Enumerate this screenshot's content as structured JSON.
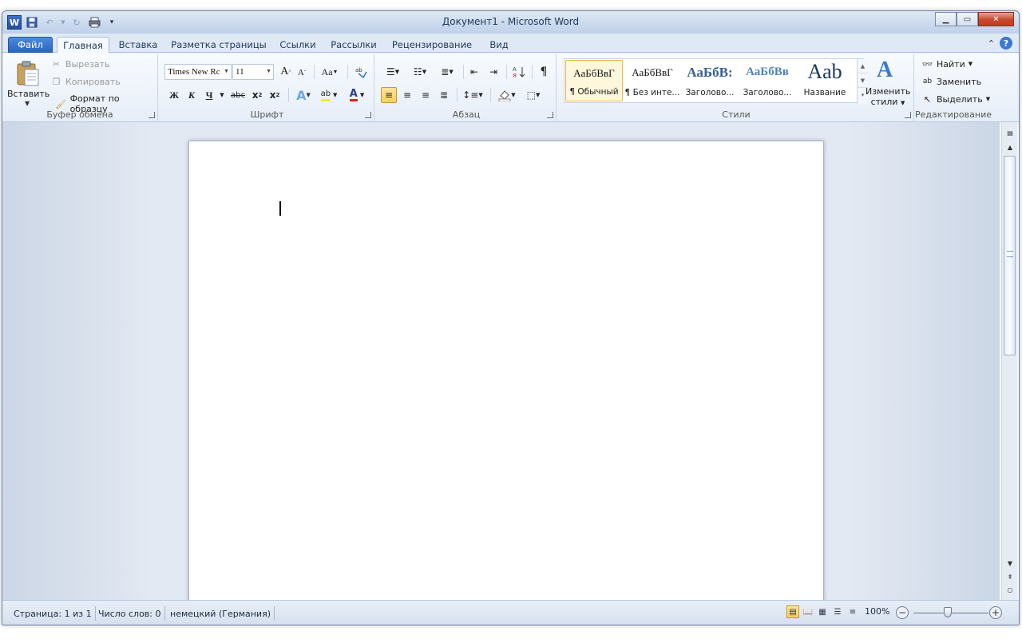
{
  "window": {
    "title": "Документ1  -  Microsoft Word"
  },
  "qat": {
    "app_icon": "word-logo",
    "app_letter": "W",
    "buttons": [
      "save-icon",
      "undo-icon",
      "redo-icon",
      "print-icon",
      "customize-icon"
    ]
  },
  "tabs": {
    "file": "Файл",
    "items": [
      "Главная",
      "Вставка",
      "Разметка страницы",
      "Ссылки",
      "Рассылки",
      "Рецензирование",
      "Вид"
    ],
    "active": "Главная"
  },
  "clipboard": {
    "paste": "Вставить",
    "cut": "Вырезать",
    "copy": "Копировать",
    "format_painter": "Формат по образцу",
    "label": "Буфер обмена"
  },
  "font": {
    "family": "Times New Rc",
    "size": "11",
    "grow": "A",
    "shrink": "A",
    "case": "Aa",
    "bold": "Ж",
    "italic": "К",
    "underline": "Ч",
    "strike": "abc",
    "subscript": "x",
    "superscript": "x",
    "effects": "A",
    "highlight": "ab",
    "color": "A",
    "label": "Шрифт"
  },
  "paragraph": {
    "pilcrow": "¶",
    "label": "Абзац"
  },
  "styles": {
    "items": [
      {
        "preview": "АаБбВвГ",
        "name": "¶ Обычный"
      },
      {
        "preview": "АаБбВвГ",
        "name": "¶ Без инте..."
      },
      {
        "preview": "АаБбВ:",
        "name": "Заголово..."
      },
      {
        "preview": "АаБбВв",
        "name": "Заголово..."
      },
      {
        "preview": "Аab",
        "name": "Название"
      }
    ],
    "change_line1": "Изменить",
    "change_line2": "стили",
    "label": "Стили"
  },
  "editing": {
    "find": "Найти",
    "replace": "Заменить",
    "select": "Выделить",
    "label": "Редактирование"
  },
  "statusbar": {
    "page": "Страница: 1 из 1",
    "words": "Число слов: 0",
    "language": "немецкий (Германия)",
    "zoom": "100%",
    "zoom_level_percent": 100
  },
  "colors": {
    "accent": "#2a65c1",
    "selected": "#fbcf5b",
    "font_color": "#d9251c",
    "highlight": "#f4f410"
  }
}
